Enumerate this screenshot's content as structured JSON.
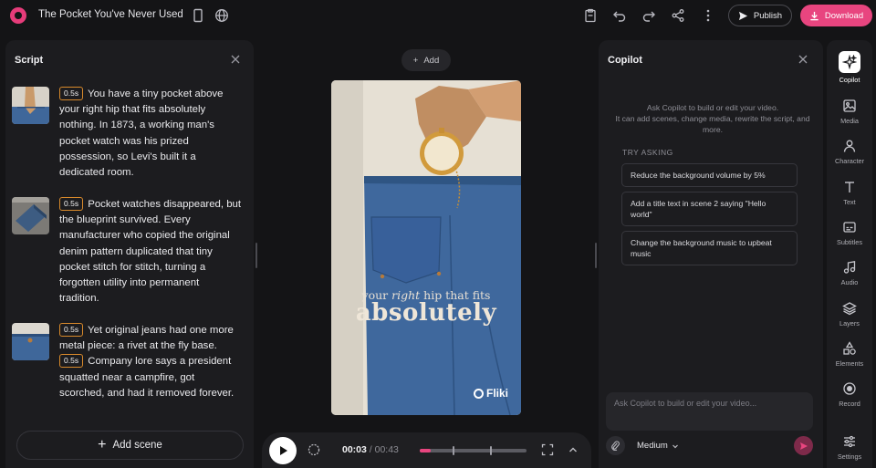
{
  "project": {
    "title": "The Pocket You've Never Used"
  },
  "toolbar": {
    "publish_label": "Publish",
    "download_label": "Download"
  },
  "script_panel": {
    "title": "Script",
    "scenes": [
      {
        "duration": "0.5s",
        "text": "You have a tiny pocket above your right hip that fits absolutely nothing. In 1873, a working man's pocket watch was his prized possession, so Levi's built it a dedicated room."
      },
      {
        "duration": "0.5s",
        "text": "Pocket watches disappeared, but the blueprint survived. Every manufacturer who copied the original denim pattern duplicated that tiny pocket stitch for stitch, turning a forgotten utility into permanent tradition."
      },
      {
        "duration": "0.5s",
        "text": "Yet original jeans had one more metal piece: a rivet at the fly base.",
        "duration2": "0.5s",
        "text2": "Company lore says a president squatted near a campfire, got scorched, and had it removed forever."
      }
    ],
    "add_scene_label": "Add scene"
  },
  "center": {
    "add_label": "Add",
    "caption_line1_a": "your ",
    "caption_line1_b": "right",
    "caption_line1_c": " hip that fits",
    "caption_line2": "absolutely",
    "watermark": "Fliki",
    "player": {
      "current_time": "00:03",
      "separator": "/",
      "total_time": "00:43",
      "progress": 0.1
    }
  },
  "copilot": {
    "title": "Copilot",
    "intro_line1": "Ask Copilot to build or edit your video.",
    "intro_line2": "It can add scenes, change media, rewrite the script, and more.",
    "try_asking_label": "TRY ASKING",
    "suggestions": [
      "Reduce the background volume by 5%",
      "Add a title text in scene 2 saying \"Hello world\"",
      "Change the background music to upbeat music"
    ],
    "input_placeholder": "Ask Copilot to build or edit your video...",
    "quality": "Medium"
  },
  "rail": {
    "items": [
      {
        "label": "Copilot",
        "icon": "sparkles-icon"
      },
      {
        "label": "Media",
        "icon": "image-icon"
      },
      {
        "label": "Character",
        "icon": "person-icon"
      },
      {
        "label": "Text",
        "icon": "text-icon"
      },
      {
        "label": "Subtitles",
        "icon": "subtitles-icon"
      },
      {
        "label": "Audio",
        "icon": "music-note-icon"
      },
      {
        "label": "Layers",
        "icon": "layers-icon"
      },
      {
        "label": "Elements",
        "icon": "shapes-icon"
      },
      {
        "label": "Record",
        "icon": "record-icon"
      },
      {
        "label": "Settings",
        "icon": "sliders-icon"
      }
    ]
  },
  "colors": {
    "accent": "#e8457f",
    "duration_badge": "#d98a2b",
    "background": "#141416",
    "panel": "#1c1c1f"
  }
}
